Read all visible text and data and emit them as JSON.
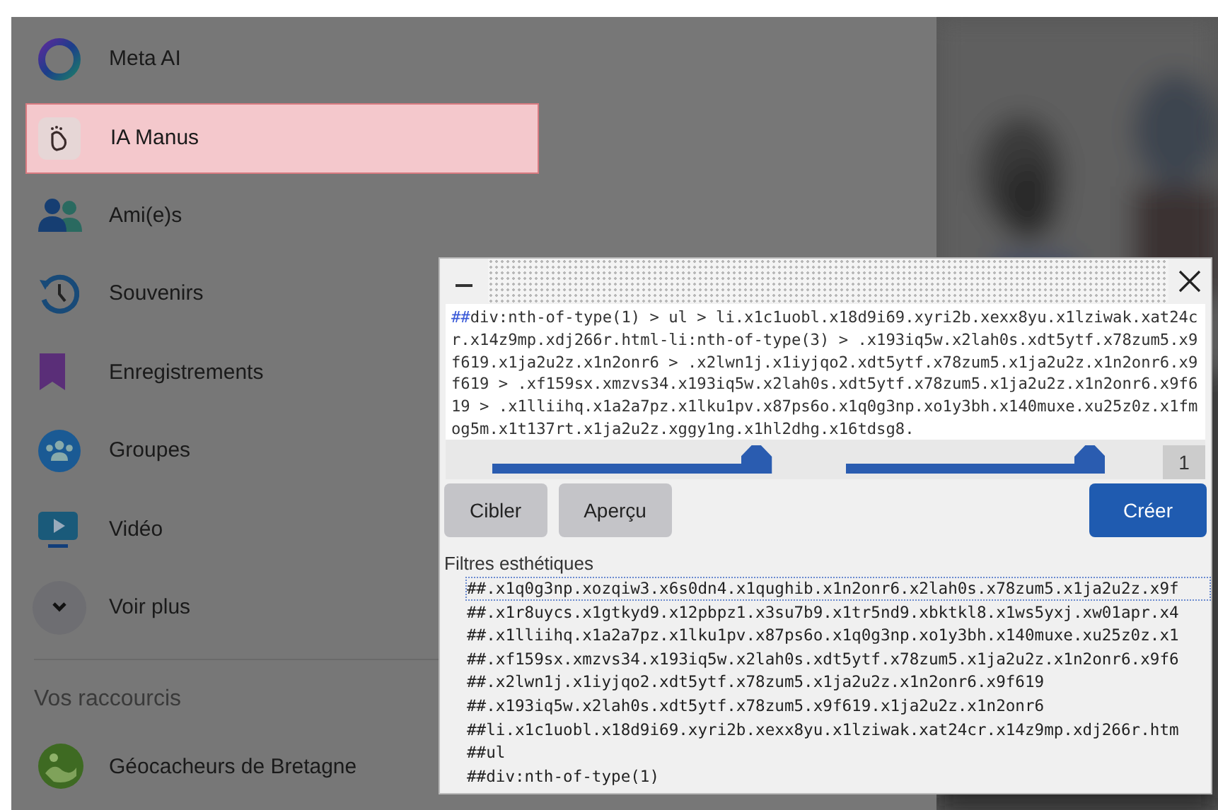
{
  "sidebar": {
    "items": [
      {
        "label": "Meta AI",
        "selected": false,
        "kind": "nav"
      },
      {
        "label": "IA Manus",
        "selected": true,
        "kind": "nav"
      },
      {
        "label": "Ami(e)s",
        "selected": false,
        "kind": "nav"
      },
      {
        "label": "Souvenirs",
        "selected": false,
        "kind": "nav"
      },
      {
        "label": "Enregistrements",
        "selected": false,
        "kind": "nav"
      },
      {
        "label": "Groupes",
        "selected": false,
        "kind": "nav"
      },
      {
        "label": "Vidéo",
        "selected": false,
        "kind": "nav"
      },
      {
        "label": "Voir plus",
        "selected": false,
        "kind": "expander"
      }
    ],
    "shortcuts": {
      "title": "Vos raccourcis",
      "items": [
        {
          "label": "Géocacheurs de Bretagne"
        }
      ]
    }
  },
  "dialog": {
    "editor": {
      "marker": "##",
      "value": "div:nth-of-type(1) > ul > li.x1c1uobl.x18d9i69.xyri2b.xexx8yu.x1lziwak.xat24cr.x14z9mp.xdj266r.html-li:nth-of-type(3) > .x193iq5w.x2lah0s.xdt5ytf.x78zum5.x9f619.x1ja2u2z.x1n2onr6 > .x2lwn1j.x1iyjqo2.xdt5ytf.x78zum5.x1ja2u2z.x1n2onr6.x9f619 > .xf159sx.xmzvs34.x193iq5w.x2lah0s.xdt5ytf.x78zum5.x1ja2u2z.x1n2onr6.x9f619 > .x1lliihq.x1a2a7pz.x1lku1pv.x87ps6o.x1q0g3np.xo1y3bh.x140muxe.xu25z0z.x1fmog5m.x1t137rt.x1ja2u2z.xggy1ng.x1hl2dhg.x16tdsg8."
    },
    "sliders": [
      {
        "level": 0.94
      },
      {
        "level": 0.93
      }
    ],
    "count": "1",
    "buttons": [
      {
        "label": "Cibler",
        "kind": "secondary"
      },
      {
        "label": "Aperçu",
        "kind": "secondary"
      },
      {
        "label": "Créer",
        "kind": "primary"
      }
    ],
    "filters_label": "Filtres esthétiques",
    "filters": [
      {
        "text": "##.x1q0g3np.xozqiw3.x6s0dn4.x1qughib.x1n2onr6.x2lah0s.x78zum5.x1ja2u2z.x9f",
        "focused": true
      },
      {
        "text": "##.x1r8uycs.x1gtkyd9.x12pbpz1.x3su7b9.x1tr5nd9.xbktkl8.x1ws5yxj.xw01apr.x4",
        "focused": false
      },
      {
        "text": "##.x1lliihq.x1a2a7pz.x1lku1pv.x87ps6o.x1q0g3np.xo1y3bh.x140muxe.xu25z0z.x1",
        "focused": false
      },
      {
        "text": "##.xf159sx.xmzvs34.x193iq5w.x2lah0s.xdt5ytf.x78zum5.x1ja2u2z.x1n2onr6.x9f6",
        "focused": false
      },
      {
        "text": "##.x2lwn1j.x1iyjqo2.xdt5ytf.x78zum5.x1ja2u2z.x1n2onr6.x9f619",
        "focused": false
      },
      {
        "text": "##.x193iq5w.x2lah0s.xdt5ytf.x78zum5.x9f619.x1ja2u2z.x1n2onr6",
        "focused": false
      },
      {
        "text": "##li.x1c1uobl.x18d9i69.xyri2b.xexx8yu.x1lziwak.xat24cr.x14z9mp.xdj266r.htm",
        "focused": false
      },
      {
        "text": "##ul",
        "focused": false
      },
      {
        "text": "##div:nth-of-type(1)",
        "focused": false
      }
    ]
  }
}
